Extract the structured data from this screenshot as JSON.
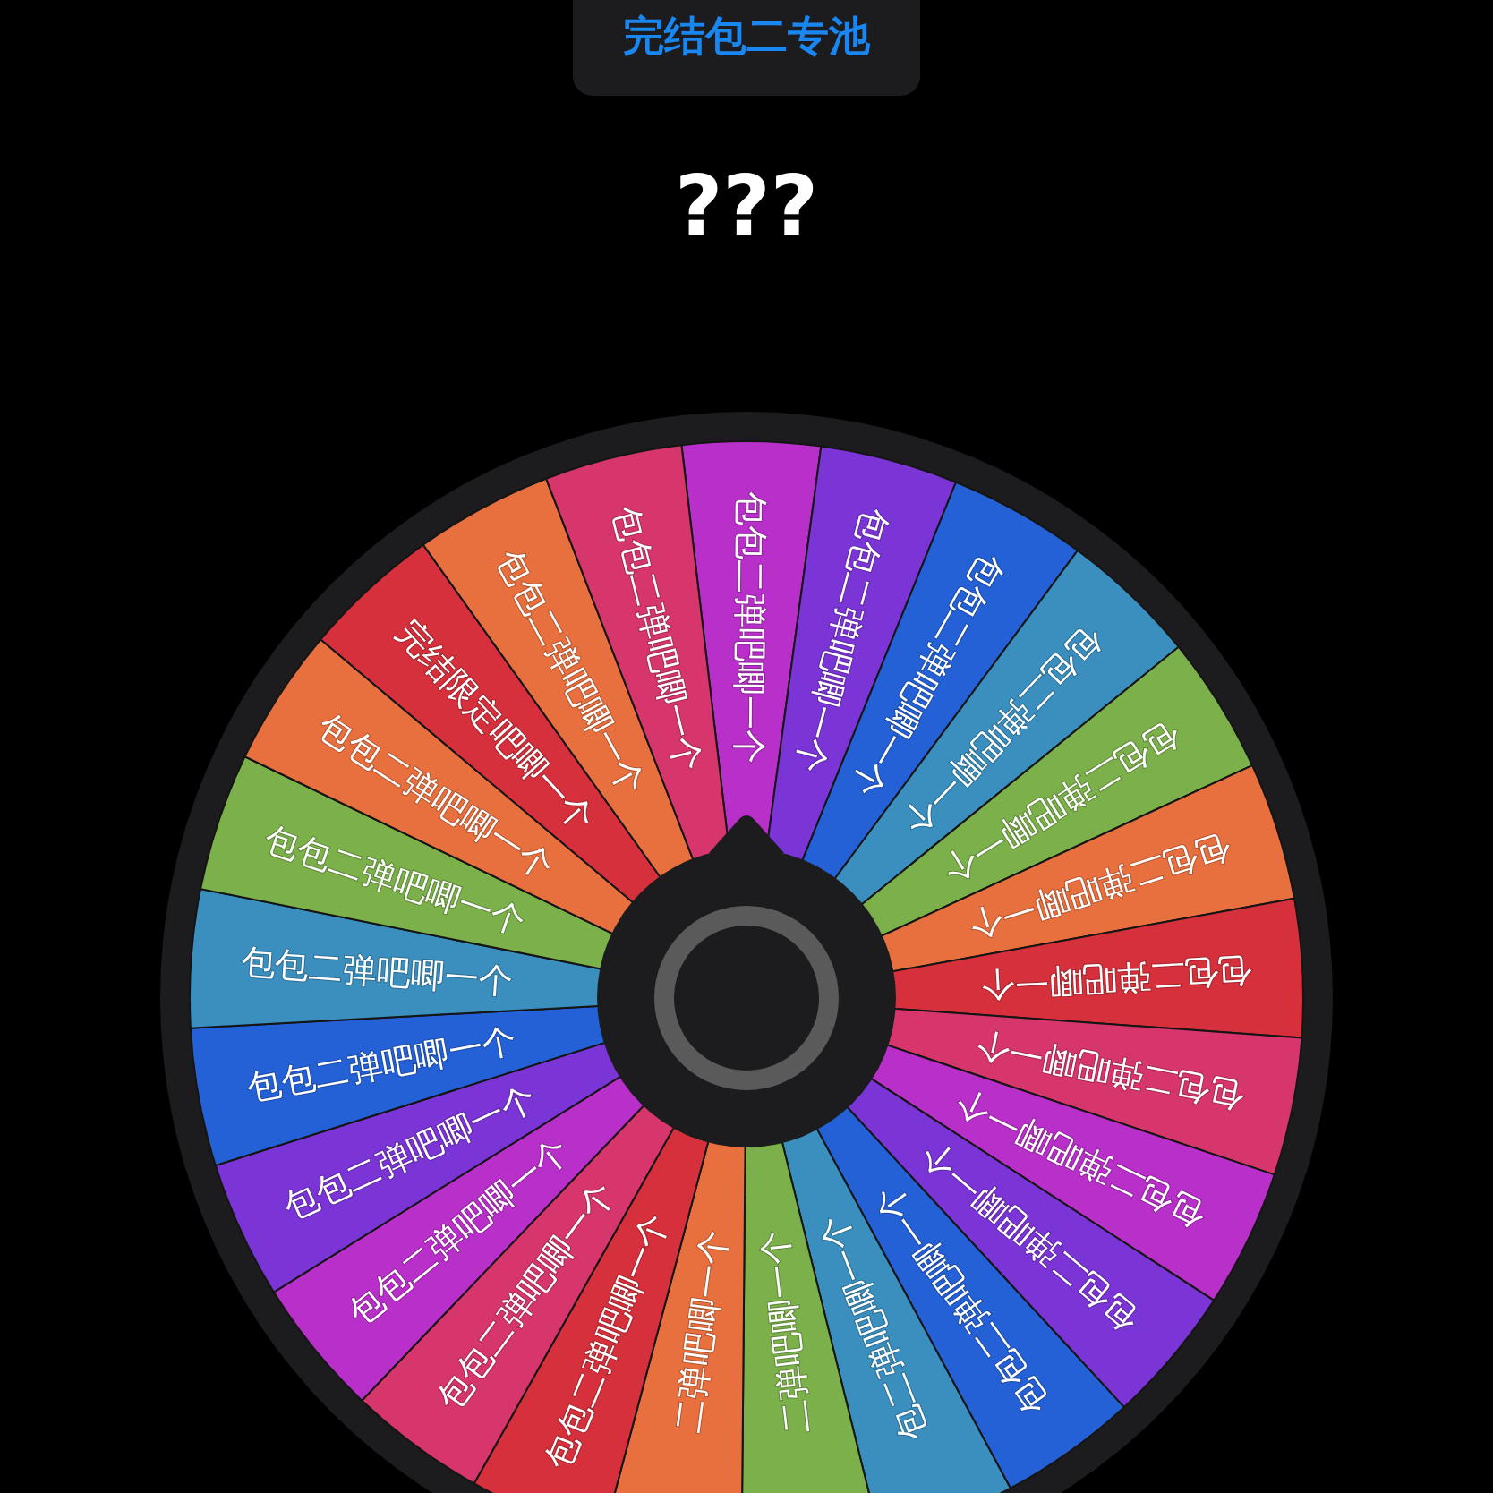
{
  "header": {
    "title": "完结包二专池"
  },
  "result": {
    "text": "???"
  },
  "wheel": {
    "segments": [
      {
        "label": "包包二弹吧唧一个",
        "color": "#b92fc9"
      },
      {
        "label": "包包二弹吧唧一个",
        "color": "#7b34d6"
      },
      {
        "label": "包包二弹吧唧一个",
        "color": "#2461d6"
      },
      {
        "label": "包包二弹吧唧一个",
        "color": "#3a8fbf"
      },
      {
        "label": "包包二弹吧唧一个",
        "color": "#7bb04a"
      },
      {
        "label": "包包二弹吧唧一个",
        "color": "#e8703f"
      },
      {
        "label": "包包二弹吧唧一个",
        "color": "#d5303b"
      },
      {
        "label": "包包二弹吧唧一个",
        "color": "#d6366b"
      },
      {
        "label": "包包二弹吧唧一个",
        "color": "#b92fc9"
      },
      {
        "label": "包包二弹吧唧一个",
        "color": "#7b34d6"
      },
      {
        "label": "包包二弹吧唧一个",
        "color": "#2461d6"
      },
      {
        "label": "包二弹吧唧一个",
        "color": "#3a8fbf"
      },
      {
        "label": "二弹吧唧一个",
        "color": "#7bb04a"
      },
      {
        "label": "二弹吧唧一个",
        "color": "#e8703f"
      },
      {
        "label": "包包二弹吧唧一个",
        "color": "#d5303b"
      },
      {
        "label": "包包二弹吧唧一个",
        "color": "#d6366b"
      },
      {
        "label": "包包二弹吧唧一个",
        "color": "#b92fc9"
      },
      {
        "label": "包包二弹吧唧一个",
        "color": "#7b34d6"
      },
      {
        "label": "包包二弹吧唧一个",
        "color": "#2461d6"
      },
      {
        "label": "包包二弹吧唧一个",
        "color": "#3a8fbf"
      },
      {
        "label": "包包二弹吧唧一个",
        "color": "#7bb04a"
      },
      {
        "label": "包包二弹吧唧一个",
        "color": "#e8703f"
      },
      {
        "label": "完结限定吧唧一个",
        "color": "#d5303b"
      },
      {
        "label": "包包二弹吧唧一个",
        "color": "#e8703f"
      },
      {
        "label": "包包二弹吧唧一个",
        "color": "#d6366b"
      }
    ]
  }
}
